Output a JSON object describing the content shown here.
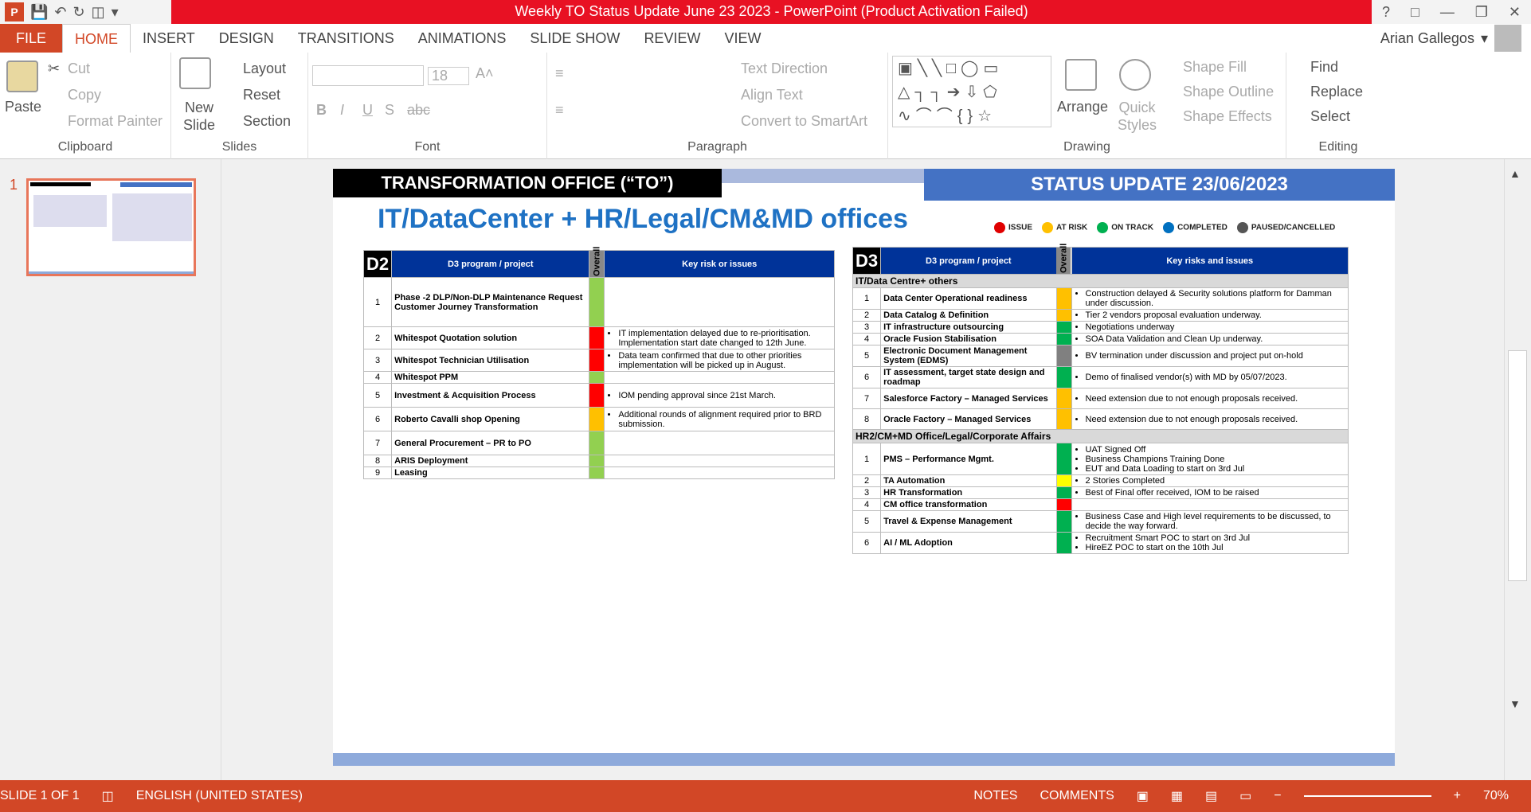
{
  "titlebar": {
    "title": "Weekly TO Status Update June 23 2023 - PowerPoint (Product Activation Failed)"
  },
  "menu": {
    "file": "FILE",
    "tabs": [
      "HOME",
      "INSERT",
      "DESIGN",
      "TRANSITIONS",
      "ANIMATIONS",
      "SLIDE SHOW",
      "REVIEW",
      "VIEW"
    ]
  },
  "user": {
    "name": "Arian Gallegos"
  },
  "ribbon": {
    "clipboard": {
      "label": "Clipboard",
      "paste": "Paste",
      "cut": "Cut",
      "copy": "Copy",
      "format_painter": "Format Painter"
    },
    "slides": {
      "label": "Slides",
      "new_slide": "New Slide",
      "layout": "Layout",
      "reset": "Reset",
      "section": "Section"
    },
    "font": {
      "label": "Font",
      "size": "18"
    },
    "paragraph": {
      "label": "Paragraph",
      "text_direction": "Text Direction",
      "align_text": "Align Text",
      "convert": "Convert to SmartArt"
    },
    "drawing": {
      "label": "Drawing",
      "arrange": "Arrange",
      "quick_styles": "Quick Styles",
      "shape_fill": "Shape Fill",
      "shape_outline": "Shape Outline",
      "shape_effects": "Shape Effects"
    },
    "editing": {
      "label": "Editing",
      "find": "Find",
      "replace": "Replace",
      "select": "Select"
    }
  },
  "thumb": {
    "number": "1"
  },
  "slide": {
    "to_banner": "TRANSFORMATION OFFICE (“TO”)",
    "status_banner": "STATUS UPDATE 23/06/2023",
    "title": "IT/DataCenter + HR/Legal/CM&MD offices",
    "legend": [
      {
        "label": "ISSUE",
        "color": "#e00000"
      },
      {
        "label": "AT RISK",
        "color": "#ffc000"
      },
      {
        "label": "ON TRACK",
        "color": "#00b050"
      },
      {
        "label": "COMPLETED",
        "color": "#0070c0"
      },
      {
        "label": "PAUSED/CANCELLED",
        "color": "#555555"
      }
    ],
    "d2": {
      "label": "D2",
      "col_program": "D3 program / project",
      "col_overall": "Overall",
      "col_risk": "Key risk or issues",
      "rows": [
        {
          "n": "1",
          "name": "Phase -2 DLP/Non-DLP Maintenance Request Customer Journey Transformation",
          "color": "#92d050",
          "risks": []
        },
        {
          "n": "2",
          "name": "Whitespot Quotation solution",
          "color": "#ff0000",
          "risks": [
            "IT implementation delayed due to re-prioritisation. Implementation start date changed to 12th June."
          ]
        },
        {
          "n": "3",
          "name": "Whitespot Technician Utilisation",
          "color": "#ff0000",
          "risks": [
            "Data team confirmed that due to other priorities implementation will be picked up in August."
          ]
        },
        {
          "n": "4",
          "name": "Whitespot PPM",
          "color": "#92d050",
          "risks": []
        },
        {
          "n": "5",
          "name": "Investment & Acquisition Process",
          "color": "#ff0000",
          "risks": [
            "IOM pending approval since 21st March."
          ]
        },
        {
          "n": "6",
          "name": "Roberto Cavalli shop Opening",
          "color": "#ffc000",
          "risks": [
            "Additional rounds of alignment required prior to BRD submission."
          ]
        },
        {
          "n": "7",
          "name": "General Procurement – PR to PO",
          "color": "#92d050",
          "risks": []
        },
        {
          "n": "8",
          "name": "ARIS Deployment",
          "color": "#92d050",
          "risks": []
        },
        {
          "n": "9",
          "name": "Leasing",
          "color": "#92d050",
          "risks": []
        }
      ]
    },
    "d3": {
      "label": "D3",
      "col_program": "D3 program / project",
      "col_overall": "Overall",
      "col_risk": "Key risks and issues",
      "sections": [
        {
          "title": "IT/Data Centre+ others",
          "rows": [
            {
              "n": "1",
              "name": "Data Center Operational readiness",
              "color": "#ffc000",
              "risks": [
                "Construction delayed & Security solutions platform for Damman under discussion."
              ]
            },
            {
              "n": "2",
              "name": "Data Catalog & Definition",
              "color": "#ffc000",
              "risks": [
                "Tier 2 vendors proposal evaluation underway."
              ]
            },
            {
              "n": "3",
              "name": "IT infrastructure outsourcing",
              "color": "#00b050",
              "risks": [
                "Negotiations underway"
              ]
            },
            {
              "n": "4",
              "name": "Oracle Fusion Stabilisation",
              "color": "#00b050",
              "risks": [
                "SOA Data Validation and Clean Up underway."
              ]
            },
            {
              "n": "5",
              "name": "Electronic Document Management System (EDMS)",
              "color": "#808080",
              "risks": [
                "BV termination under discussion and project put on-hold"
              ]
            },
            {
              "n": "6",
              "name": "IT assessment, target state design and roadmap",
              "color": "#00b050",
              "risks": [
                "Demo of finalised vendor(s) with MD by 05/07/2023."
              ]
            },
            {
              "n": "7",
              "name": "Salesforce Factory – Managed Services",
              "color": "#ffc000",
              "risks": [
                "Need extension due to not enough proposals received."
              ]
            },
            {
              "n": "8",
              "name": "Oracle Factory – Managed Services",
              "color": "#ffc000",
              "risks": [
                "Need extension due to not enough proposals received."
              ]
            }
          ]
        },
        {
          "title": "HR2/CM+MD Office/Legal/Corporate Affairs",
          "rows": [
            {
              "n": "1",
              "name": "PMS – Performance Mgmt.",
              "color": "#00b050",
              "risks": [
                "UAT Signed Off",
                "Business Champions Training Done",
                "EUT and Data Loading to start on 3rd Jul"
              ]
            },
            {
              "n": "2",
              "name": "TA Automation",
              "color": "#ffff00",
              "risks": [
                "2 Stories Completed"
              ]
            },
            {
              "n": "3",
              "name": "HR Transformation",
              "color": "#00b050",
              "risks": [
                "Best of Final offer received, IOM to be raised"
              ]
            },
            {
              "n": "4",
              "name": "CM office transformation",
              "color": "#ff0000",
              "risks": []
            },
            {
              "n": "5",
              "name": "Travel & Expense Management",
              "color": "#00b050",
              "risks": [
                "Business Case and High level requirements to be discussed, to decide the way forward."
              ]
            },
            {
              "n": "6",
              "name": "AI / ML Adoption",
              "color": "#00b050",
              "risks": [
                "Recruitment Smart POC to start on 3rd Jul",
                "HireEZ POC to start on the 10th Jul"
              ]
            }
          ]
        }
      ]
    }
  },
  "status": {
    "slide": "SLIDE 1 OF 1",
    "language": "ENGLISH (UNITED STATES)",
    "notes": "NOTES",
    "comments": "COMMENTS",
    "zoom": "70%"
  }
}
